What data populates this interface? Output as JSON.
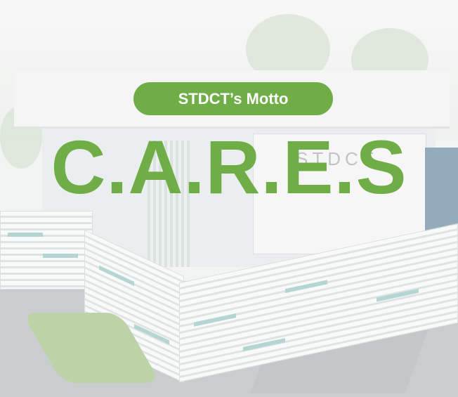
{
  "motto_label": "STDCT’s Motto",
  "motto": "C.A.R.E.S",
  "container_brand": "STDCT",
  "colors": {
    "accent": "#6fad46",
    "text_on_accent": "#ffffff"
  }
}
